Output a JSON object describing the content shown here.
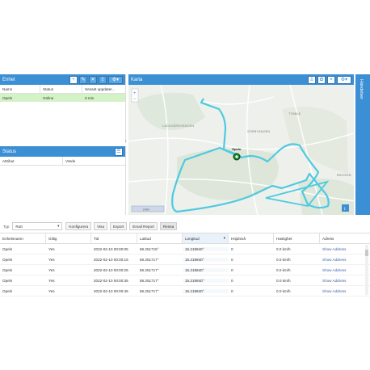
{
  "enhet": {
    "title": "Enhet",
    "columns": [
      "Namn",
      "Status",
      "Senast uppdater..."
    ],
    "row": {
      "name": "Opeln",
      "status": "Online",
      "updated": "0 min"
    }
  },
  "status_panel": {
    "title": "Status",
    "columns": [
      "Attribut",
      "Värde"
    ]
  },
  "karta": {
    "title": "Karta",
    "labels": {
      "marker": "Opeln",
      "area1": "LADUGÅRDSÄNGEN",
      "area2": "SÖRBYÄNGEN",
      "area3": "TYBBLE",
      "area4": "BRICKEB"
    },
    "scale": "2 km",
    "zoom_in": "+",
    "zoom_out": "−"
  },
  "handelser": {
    "title": "Händelser"
  },
  "bottom_toolbar": {
    "type_label": "Typ",
    "type_value": "Rutt",
    "buttons": [
      "Konfigurera",
      "Visa",
      "Export",
      "Email Report",
      "Rensa"
    ]
  },
  "route_table": {
    "columns": [
      "Enhetsnamn",
      "Giltig",
      "Tid",
      "Latitud",
      "Longitud",
      "Höjdnivå",
      "Hastighet",
      "Adress"
    ],
    "rows": [
      [
        "Opeln",
        "Yes",
        "2022-02-10 00:00:05",
        "59.251715°",
        "15.219940°",
        "0",
        "0.0 km/h",
        "Show Address"
      ],
      [
        "Opeln",
        "Yes",
        "2022-02-10 00:00:15",
        "59.251717°",
        "15.219940°",
        "0",
        "0.0 km/h",
        "Show Address"
      ],
      [
        "Opeln",
        "Yes",
        "2022-02-10 00:00:25",
        "59.251717°",
        "15.219940°",
        "0",
        "0.0 km/h",
        "Show Address"
      ],
      [
        "Opeln",
        "Yes",
        "2022-02-10 00:00:35",
        "59.251717°",
        "15.219940°",
        "0",
        "0.0 km/h",
        "Show Address"
      ],
      [
        "Opeln",
        "Yes",
        "2022-02-10 00:00:45",
        "59.251717°",
        "15.219940°",
        "0",
        "0.0 km/h",
        "Show Address"
      ]
    ]
  },
  "colors": {
    "header_blue": "#3b8fd4",
    "route": "#4ecae0",
    "selected_row": "#d3f2c6"
  },
  "icons": [
    "plus-icon",
    "pencil-icon",
    "close-icon",
    "upload-icon",
    "gear-icon",
    "list-icon",
    "walker-icon",
    "paw-icon",
    "target-icon",
    "info-icon"
  ]
}
